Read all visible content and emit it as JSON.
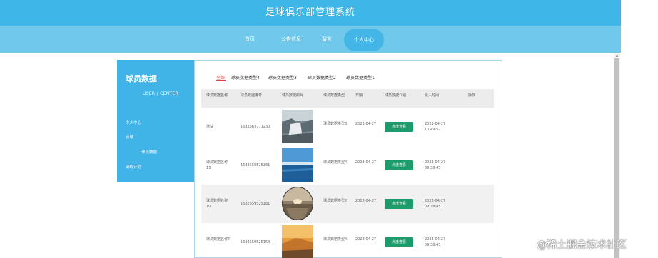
{
  "header": {
    "title": "足球俱乐部管理系统"
  },
  "nav": {
    "items": [
      "首页",
      "公告信息",
      "留言",
      "个人中心"
    ],
    "active_index": 3
  },
  "sidebar": {
    "title": "球员数据",
    "subtitle": "USER / CENTER",
    "items": [
      "个人中心",
      "点球",
      "球员数据",
      "训练计划"
    ]
  },
  "tabs": [
    "全部",
    "球员数据类型4",
    "球员数据类型3",
    "球员数据类型2",
    "球员数据类型1"
  ],
  "table": {
    "headers": [
      "球员数据名称",
      "球员数据编号",
      "球员数据照片",
      "球员数据类型",
      "日期",
      "球员数据介绍",
      "录入时间",
      "操作"
    ],
    "button_label": "点击查看",
    "rows": [
      {
        "name": "测试",
        "code": "1682563771230",
        "type": "球员数据类型3",
        "date": "2023-04-27",
        "created": "2023-04-27 10:49:57"
      },
      {
        "name": "球员数据名称13",
        "code": "1682559525161",
        "type": "球员数据类型4",
        "date": "2023-04-27",
        "created": "2023-04-27 09:38:45"
      },
      {
        "name": "球员数据名称10",
        "code": "1682559525181",
        "type": "球员数据类型2",
        "date": "2023-04-27",
        "created": "2023-04-27 09:38:45"
      },
      {
        "name": "球员数据名称7",
        "code": "1682559525154",
        "type": "球员数据类型4",
        "date": "2023-04-27",
        "created": "2023-04-27 09:38:45"
      }
    ]
  },
  "watermark": "@稀土掘金技术社区",
  "colors": {
    "header": "#3fb6e8",
    "nav": "#70c9ea",
    "sidebar": "#40b3e7",
    "button": "#1e9b6b",
    "active_tab": "#e04040"
  }
}
